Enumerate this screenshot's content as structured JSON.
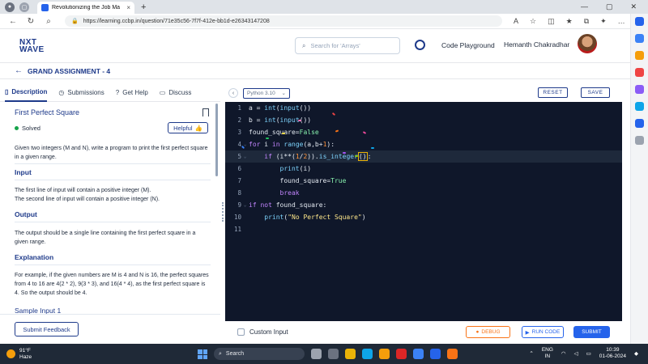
{
  "browser": {
    "tab_title": "Revolutionizing the Job Ma",
    "url": "https://learning.ccbp.in/question/71e35c56-7f7f-412e-bb1d-e26343147208"
  },
  "header": {
    "logo_line1": "NXT",
    "logo_line2": "WAVE",
    "search_placeholder": "Search for 'Arrays'",
    "code_playground": "Code Playground",
    "user_name": "Hemanth Chakradhar"
  },
  "assignment": {
    "title": "GRAND ASSIGNMENT - 4"
  },
  "left_tabs": [
    {
      "label": "Description"
    },
    {
      "label": "Submissions"
    },
    {
      "label": "Get Help"
    },
    {
      "label": "Discuss"
    }
  ],
  "problem": {
    "title": "First Perfect Square",
    "status": "Solved",
    "helpful": "Helpful",
    "description": "Given two integers (M and N), write a program to print the first perfect square in a given range.",
    "input_heading": "Input",
    "input_line1": "The first line of input will contain a positive integer (M).",
    "input_line2": "The second line of input will contain a positive integer (N).",
    "output_heading": "Output",
    "output_text": "The output should be a single line containing the first perfect square in a given range.",
    "explanation_heading": "Explanation",
    "explanation_text": "For example, if the given numbers are M is 4 and N is 16, the perfect squares from 4 to 16 are 4(2 * 2), 9(3 * 3), and 16(4 * 4), as the first perfect square is 4. So the output should be 4.",
    "sample_heading": "Sample Input 1",
    "feedback": "Submit Feedback"
  },
  "editor": {
    "language": "Python 3.10",
    "reset": "RESET",
    "save": "SAVE",
    "line_numbers": [
      "1",
      "2",
      "3",
      "4",
      "5",
      "6",
      "7",
      "8",
      "9",
      "10",
      "11"
    ],
    "custom_input": "Custom Input",
    "debug": "DEBUG",
    "run_code": "RUN CODE",
    "submit": "SUBMIT"
  },
  "taskbar": {
    "temp": "91°F",
    "weather": "Haze",
    "search": "Search",
    "lang1": "ENG",
    "lang2": "IN",
    "time": "10:39",
    "date": "01-06-2024"
  },
  "colors": {
    "brand": "#1e3a8a",
    "editor_bg": "#0f172a",
    "primary": "#2563eb",
    "debug": "#f97316",
    "solved": "#16a34a"
  }
}
